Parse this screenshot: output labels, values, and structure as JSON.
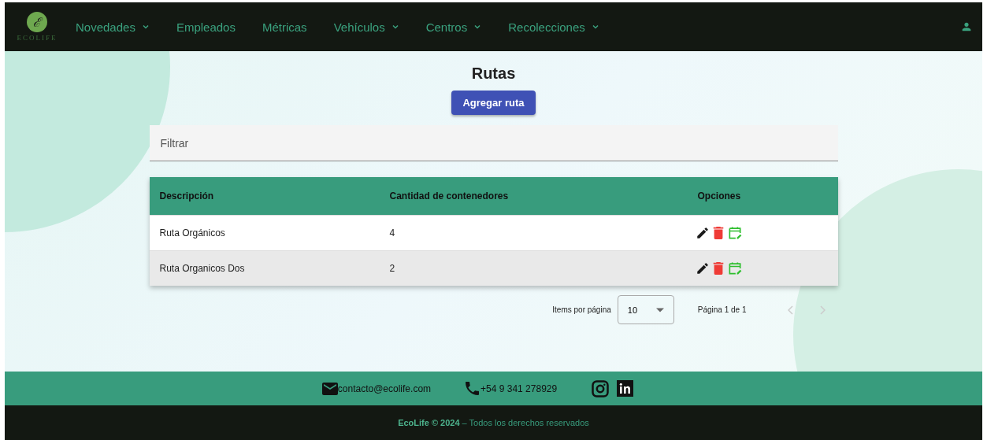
{
  "header": {
    "logo_text": "ECOLIFE",
    "logo_letter": "ℰ",
    "nav": [
      {
        "label": "Novedades",
        "dropdown": true
      },
      {
        "label": "Empleados",
        "dropdown": false
      },
      {
        "label": "Métricas",
        "dropdown": false
      },
      {
        "label": "Vehículos",
        "dropdown": true
      },
      {
        "label": "Centros",
        "dropdown": true
      },
      {
        "label": "Recolecciones",
        "dropdown": true
      }
    ]
  },
  "page": {
    "title": "Rutas",
    "add_button": "Agregar ruta",
    "filter": {
      "placeholder": "Filtrar"
    }
  },
  "table": {
    "columns": [
      "Descripción",
      "Cantidad de contenedores",
      "Opciones"
    ],
    "rows": [
      {
        "description": "Ruta Orgánicos",
        "count": "4"
      },
      {
        "description": "Ruta Organicos Dos",
        "count": "2"
      }
    ]
  },
  "paginator": {
    "items_label": "Items por página",
    "page_size": "10",
    "range": "Página 1 de 1",
    "prev_disabled": true,
    "next_disabled": true
  },
  "footer": {
    "email": "contacto@ecolife.com",
    "phone": "+54 9 341 278929",
    "copyright": "**EcoLife © 2024** – Todos los derechos reservados"
  }
}
